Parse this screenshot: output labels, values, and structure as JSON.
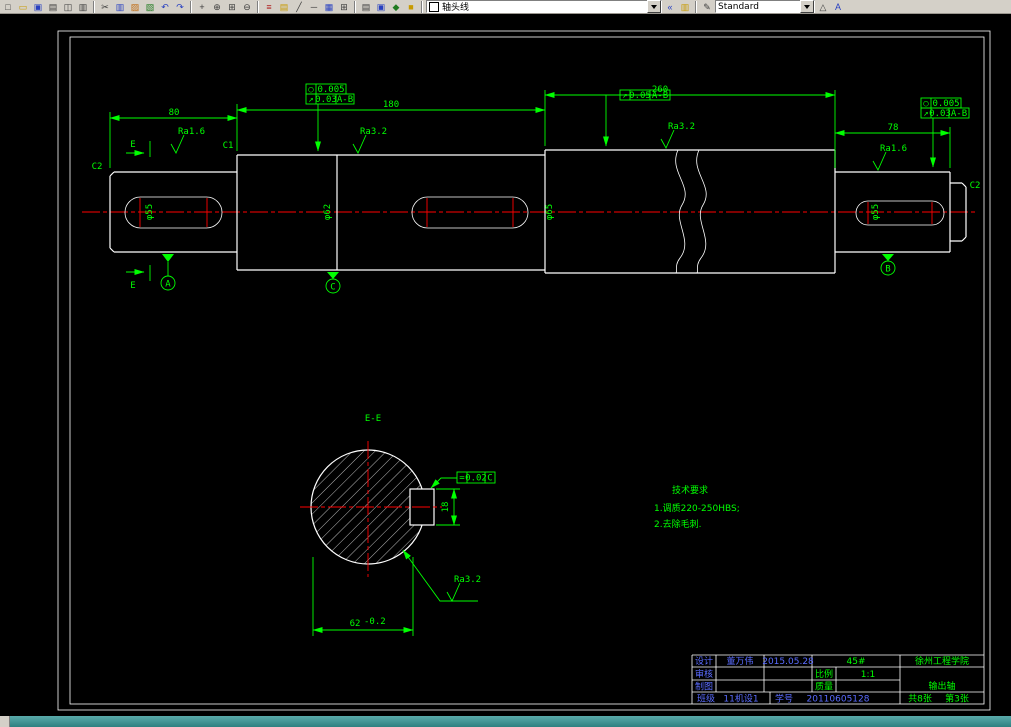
{
  "toolbar": {
    "layer_combo_value": "轴头线",
    "style_combo_value": "Standard",
    "icons": [
      {
        "name": "new-icon",
        "glyph": "□"
      },
      {
        "name": "open-icon",
        "glyph": "▭"
      },
      {
        "name": "save-icon",
        "glyph": "▣"
      },
      {
        "name": "plot-icon",
        "glyph": "▤"
      },
      {
        "name": "preview-icon",
        "glyph": "◫"
      },
      {
        "name": "publish-icon",
        "glyph": "▥"
      },
      {
        "name": "cut-icon",
        "glyph": "✂"
      },
      {
        "name": "copy-icon",
        "glyph": "▥"
      },
      {
        "name": "paste-icon",
        "glyph": "▨"
      },
      {
        "name": "match-properties-icon",
        "glyph": "▧"
      },
      {
        "name": "undo-icon",
        "glyph": "↶"
      },
      {
        "name": "redo-icon",
        "glyph": "↷"
      },
      {
        "name": "pan-icon",
        "glyph": "+"
      },
      {
        "name": "zoom-realtime-icon",
        "glyph": "⊕"
      },
      {
        "name": "zoom-window-icon",
        "glyph": "⊞"
      },
      {
        "name": "zoom-previous-icon",
        "glyph": "⊖"
      },
      {
        "name": "layers-icon",
        "glyph": "≡"
      },
      {
        "name": "layer-properties-icon",
        "glyph": "▤"
      },
      {
        "name": "linetype-icon",
        "glyph": "╱"
      },
      {
        "name": "lineweight-icon",
        "glyph": "─"
      },
      {
        "name": "properties-icon",
        "glyph": "▦"
      },
      {
        "name": "table-icon",
        "glyph": "⊞"
      },
      {
        "name": "tool-palettes-icon",
        "glyph": "▤"
      },
      {
        "name": "markup-icon",
        "glyph": "▣"
      },
      {
        "name": "block-icon",
        "glyph": "◆"
      },
      {
        "name": "color-control-icon",
        "glyph": "■"
      },
      {
        "name": "layer-previous-icon",
        "glyph": "«"
      },
      {
        "name": "layer-states-icon",
        "glyph": "▥"
      },
      {
        "name": "pencil-icon",
        "glyph": "✎"
      },
      {
        "name": "dim-style-icon",
        "glyph": "△"
      },
      {
        "name": "text-style-icon",
        "glyph": "A"
      }
    ]
  },
  "colors": {
    "dimension_green": "#00ff00",
    "centerline_red": "#ff0000",
    "outline_white": "#ffffff",
    "handwriting_blue": "#5a6cff",
    "canvas_black": "#000000",
    "chrome_gray": "#d4d0c8",
    "taskbar_teal": "#2e8080"
  },
  "drawing": {
    "dims": {
      "d80": "80",
      "d180": "180",
      "d260": "260",
      "d78": "78",
      "d62": "62",
      "d62_tol": "-0.2",
      "d18": "18"
    },
    "diam": {
      "d1": "φ55",
      "d2": "φ62",
      "d3": "φ65",
      "d4": "φ55"
    },
    "chamfer": {
      "left": "C2",
      "mid": "C1",
      "right": "C2"
    },
    "rough": {
      "r1": "Ra1.6",
      "r2": "Ra3.2",
      "r3": "Ra3.2",
      "r4": "Ra1.6",
      "r5": "Ra3.2"
    },
    "datum": {
      "a": "A",
      "b": "B",
      "c": "C"
    },
    "sect": {
      "marker": "E",
      "label": "E-E"
    },
    "tol": {
      "tf1a_sym": "○",
      "tf1a_val": "0.005",
      "tf1b_sym": "↗",
      "tf1b_val": "0.03",
      "tf1b_ref": "A-B",
      "tf2_sym": "↗",
      "tf2_val": "0.05",
      "tf2_ref": "A-B",
      "tf3a_sym": "○",
      "tf3a_val": "0.005",
      "tf3b_sym": "↗",
      "tf3b_val": "0.03",
      "tf3b_ref": "A-B",
      "tf4_sym": "=",
      "tf4_val": "0.02",
      "tf4_ref": "C"
    },
    "tech": {
      "t0": "技术要求",
      "t1": "1.调质220-250HBS;",
      "t2": "2.去除毛刺."
    }
  },
  "title_block": {
    "design_label": "设计",
    "designer": "董万伟",
    "date": "2015.05.28",
    "material": "45#",
    "school": "徐州工程学院",
    "check_label": "审核",
    "scale_label": "比例",
    "scale": "1:1",
    "part": "输出轴",
    "draw_label": "制图",
    "mass_label": "质量",
    "class_label": "班级",
    "class_value": "11机设1",
    "sid_label": "学号",
    "sid_value": "20110605128",
    "sheets": "共8张",
    "sheet_no": "第3张"
  }
}
